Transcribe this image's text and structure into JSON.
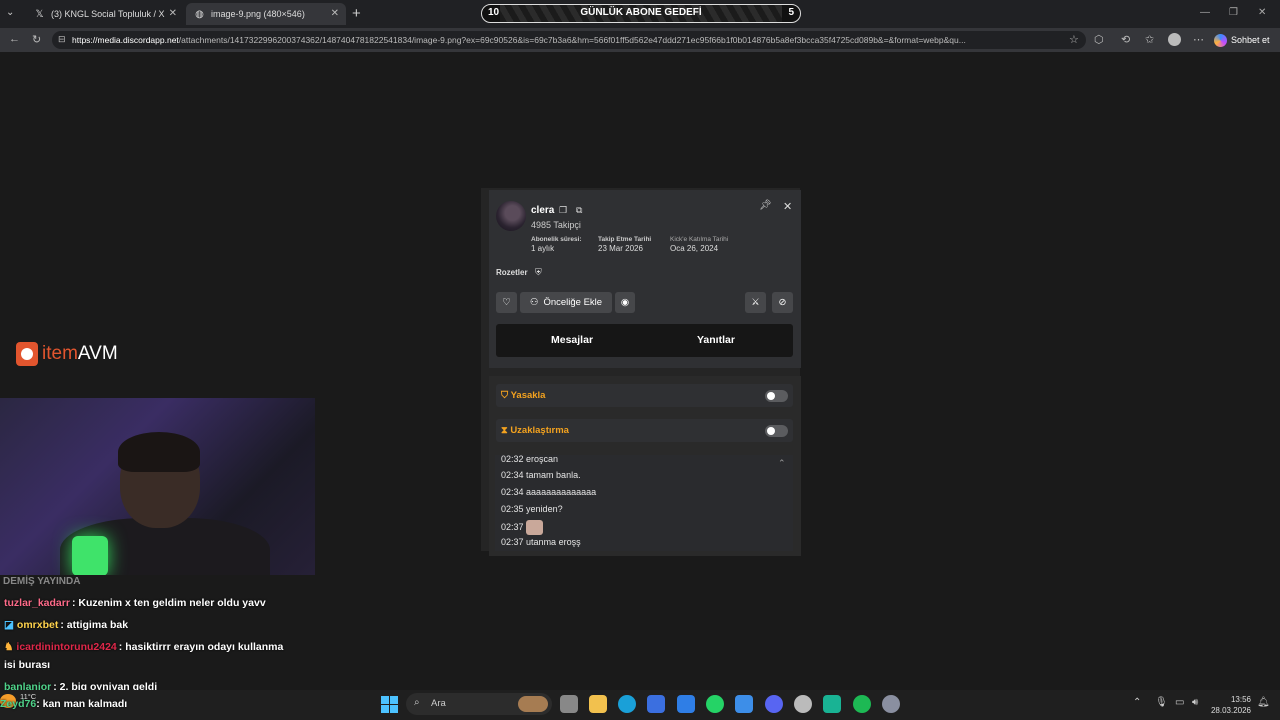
{
  "browser": {
    "tabs": [
      {
        "label": "(3) KNGL Social Topluluk / X",
        "icon": "x-logo-icon"
      },
      {
        "label": "image-9.png (480×546)",
        "icon": "globe-icon"
      }
    ],
    "url_host": "https://media.discordapp.net",
    "url_path": "/attachments/1417322996200374362/1487404781822541834/image-9.png?ex=69c90526&is=69c7b3a6&hm=566f01ff5d562e47ddd271ec95f66b1f0b014876b5a8ef3bcca35f4725cd089b&=&format=webp&qu...",
    "chat_button": "Sohbet et"
  },
  "goal": {
    "left": "10",
    "label": "GÜNLÜK ABONE GEDEFİ",
    "right": "5"
  },
  "profile": {
    "username": "clera",
    "followers": "4985 Takipçi",
    "stats": [
      {
        "label": "Abonelik süresi:",
        "value": "1 aylık"
      },
      {
        "label": "Takip Etme Tarihi",
        "value": "23 Mar 2026"
      },
      {
        "label": "Kick'e Katılma Tarihi",
        "value": "Oca 26, 2024"
      }
    ],
    "badges_label": "Rozetler",
    "priority_button": "Önceliğe Ekle",
    "tabs": [
      "Mesajlar",
      "Yanıtlar"
    ],
    "mod_actions": [
      {
        "label": "Yasakla",
        "on": false
      },
      {
        "label": "Uzaklaştırma",
        "on": false
      }
    ],
    "messages": [
      {
        "time": "02:32",
        "text": "eroşcan"
      },
      {
        "time": "02:34",
        "text": "tamam banla."
      },
      {
        "time": "02:34",
        "text": "aaaaaaaaaaaaaa"
      },
      {
        "time": "02:35",
        "text": "yeniden?"
      },
      {
        "time": "02:37",
        "text": ""
      },
      {
        "time": "02:37",
        "text": "utanma eroşş"
      }
    ]
  },
  "overlay": {
    "brand_item": "item",
    "brand_avm": "AVM",
    "chat_header": "DEMİŞ YAYINDA",
    "chat": [
      {
        "user": "tuzlar_kadarr",
        "color": "#ff6b8a",
        "text": ": Kuzenim x ten geldim neler oldu yavv"
      },
      {
        "user": "omrxbet",
        "color": "#ffd34d",
        "text": ": attigima bak"
      },
      {
        "user": "icardinintorunu2424",
        "color": "#e0284a",
        "text": ": hasiktirrr erayın odayı kullanma"
      },
      {
        "user": "",
        "color": "#ffffff",
        "text": "isi burası"
      },
      {
        "user": "banlanior",
        "color": "#4fd38a",
        "text": ": 2. big oyniyan geldi"
      },
      {
        "user": "Zeyd76",
        "color": "#4fd38a",
        "text": ": kan man kalmadı"
      }
    ]
  },
  "taskbar": {
    "search_placeholder": "Ara",
    "weather": "11°C",
    "time": "13:56",
    "date": "28.03.2026"
  }
}
